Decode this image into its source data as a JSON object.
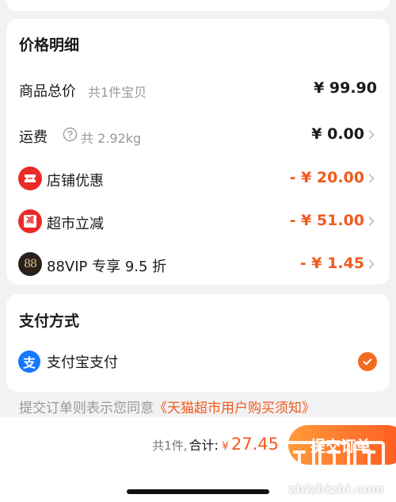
{
  "price_detail": {
    "title": "价格明细",
    "rows": [
      {
        "label": "商品总价",
        "sub": "共1件宝贝",
        "value": "¥ 99.90"
      },
      {
        "label": "运费",
        "sub": "共 2.92kg",
        "value": "¥ 0.00"
      },
      {
        "label": "店铺优惠",
        "value": "- ¥ 20.00"
      },
      {
        "label": "超市立减",
        "badge_text": "减",
        "value": "- ¥ 51.00"
      },
      {
        "label": "88VIP 专享 9.5 折",
        "badge_text": "88",
        "value": "- ¥ 1.45"
      }
    ]
  },
  "payment": {
    "title": "支付方式",
    "method_label": "支付宝支付",
    "icon_glyph": "支",
    "selected": true
  },
  "agreement": {
    "prefix": "提交订单则表示您同意",
    "link": "《天猫超市用户购买须知》"
  },
  "bottom_bar": {
    "count": "共1件,",
    "total_label": "合计:",
    "currency": "¥",
    "amount": "27.45",
    "submit_label": "提交订单"
  },
  "watermark": {
    "text": "zhizhizhi.com"
  },
  "colors": {
    "accent": "#f05a1e",
    "alipay": "#1677ff",
    "badge_red": "#ec2a2a",
    "vip_dark": "#2b211b",
    "vip_gold": "#e6c18c"
  }
}
